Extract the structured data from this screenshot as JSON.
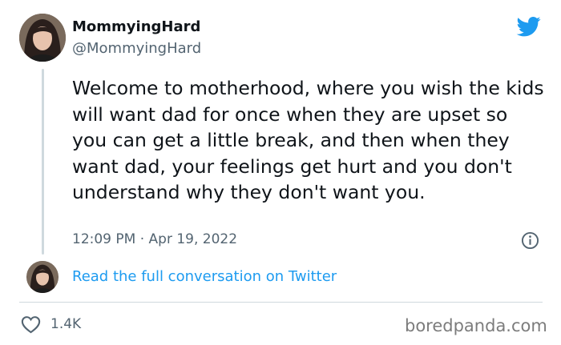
{
  "author": {
    "display_name": "MommyingHard",
    "handle": "@MommyingHard"
  },
  "tweet": {
    "text": "Welcome to motherhood, where you wish the kids will want dad for once when they are upset so you can get a little break, and then when they want dad, your feelings get hurt and you don't understand why they don't want you.",
    "timestamp": "12:09 PM · Apr 19, 2022"
  },
  "conversation_link": "Read the full conversation on Twitter",
  "actions": {
    "like_count": "1.4K"
  },
  "watermark": "boredpanda.com",
  "colors": {
    "twitter_blue": "#1d9bf0",
    "text_primary": "#0f1419",
    "text_secondary": "#536471",
    "divider": "#cfd9de"
  },
  "icons": {
    "brand": "twitter-bird-icon",
    "info": "info-icon",
    "like": "heart-icon"
  }
}
